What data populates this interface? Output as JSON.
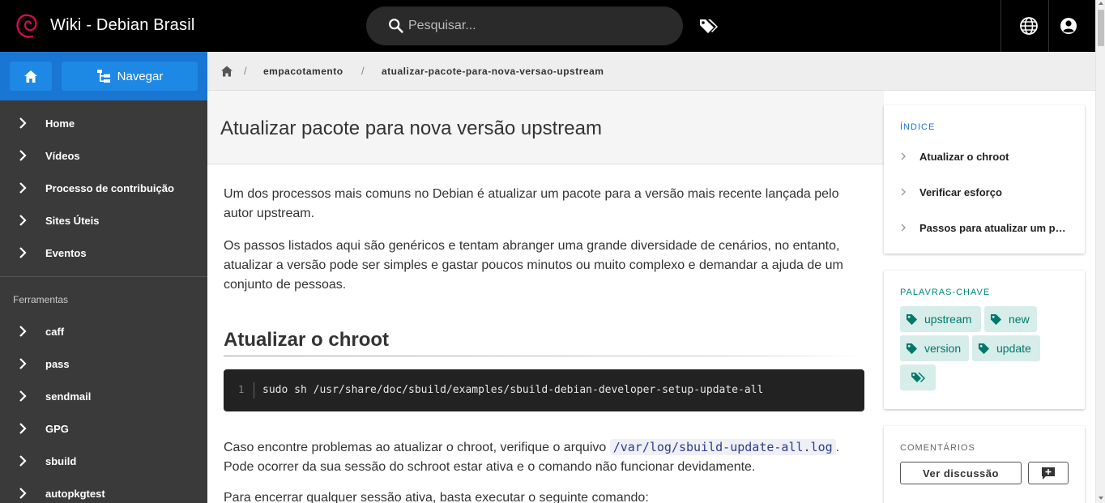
{
  "header": {
    "site_title": "Wiki - Debian Brasil",
    "search_placeholder": "Pesquisar..."
  },
  "sidebar": {
    "browse_label": "Navegar",
    "items": [
      {
        "label": "Home"
      },
      {
        "label": "Vídeos"
      },
      {
        "label": "Processo de contribuição"
      },
      {
        "label": "Sites Úteis"
      },
      {
        "label": "Eventos"
      }
    ],
    "tools_heading": "Ferramentas",
    "tools": [
      {
        "label": "caff"
      },
      {
        "label": "pass"
      },
      {
        "label": "sendmail"
      },
      {
        "label": "GPG"
      },
      {
        "label": "sbuild"
      },
      {
        "label": "autopkgtest"
      }
    ]
  },
  "breadcrumb": {
    "items": [
      "empacotamento",
      "atualizar-pacote-para-nova-versao-upstream"
    ]
  },
  "page": {
    "title": "Atualizar pacote para nova versão upstream",
    "intro_1": "Um dos processos mais comuns no Debian é atualizar um pacote para a versão mais recente lançada pelo autor upstream.",
    "intro_2": "Os passos listados aqui são genéricos e tentam abranger uma grande diversidade de cenários, no entanto, atualizar a versão pode ser simples e gastar poucos minutos ou muito complexo e demandar a ajuda de um conjunto de pessoas.",
    "section_title": "Atualizar o chroot",
    "code_line_number": "1",
    "code": "sudo sh /usr/share/doc/sbuild/examples/sbuild-debian-developer-setup-update-all",
    "para_3_before": "Caso encontre problemas ao atualizar o chroot, verifique o arquivo ",
    "para_3_code": "/var/log/sbuild-update-all.log",
    "para_3_after": ". Pode ocorrer da sua sessão do schroot estar ativa e o comando não funcionar devidamente.",
    "para_4": "Para encerrar qualquer sessão ativa, basta executar o seguinte comando:"
  },
  "toc": {
    "heading": "ÍNDICE",
    "items": [
      "Atualizar o chroot",
      "Verificar esforço",
      "Passos para atualizar um pacote"
    ]
  },
  "keywords": {
    "heading": "PALAVRAS-CHAVE",
    "tags": [
      "upstream",
      "new",
      "version",
      "update"
    ]
  },
  "comments": {
    "heading": "COMENTÁRIOS",
    "view_label": "Ver discussão"
  },
  "colors": {
    "header_bg": "#000000",
    "sidebar_bg": "#3a3a3a",
    "sidebar_top_bg": "#1976d2",
    "accent_blue": "#1976d2",
    "tag_teal": "#00796b",
    "tag_bg": "#d7ede9",
    "debian_red": "#d70a53"
  },
  "icons": {
    "logo": "debian-swirl-logo",
    "search": "search-icon",
    "tags": "tags-icon",
    "language": "globe-icon",
    "account": "account-circle-icon",
    "home": "home-icon",
    "browse": "sitemap-icon",
    "comment": "comment-add-icon"
  }
}
